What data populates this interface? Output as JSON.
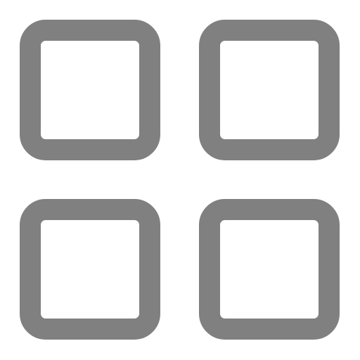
{
  "icon": {
    "name": "grid-view-icon",
    "stroke_color": "#808080",
    "background_color": "#ffffff",
    "tiles": [
      "top-left",
      "top-right",
      "bottom-left",
      "bottom-right"
    ]
  }
}
